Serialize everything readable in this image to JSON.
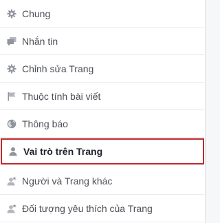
{
  "menu": {
    "items": [
      {
        "label": "Chung",
        "icon": "gear-icon"
      },
      {
        "label": "Nhắn tin",
        "icon": "message-icon"
      },
      {
        "label": "Chỉnh sửa Trang",
        "icon": "gear-icon"
      },
      {
        "label": "Thuộc tính bài viết",
        "icon": "flag-icon"
      },
      {
        "label": "Thông báo",
        "icon": "globe-icon"
      },
      {
        "label": "Vai trò trên Trang",
        "icon": "person-icon",
        "active": true
      },
      {
        "label": "Người và Trang khác",
        "icon": "person-star-icon"
      },
      {
        "label": "Đối tượng yêu thích của Trang",
        "icon": "person-star-icon"
      }
    ]
  },
  "colors": {
    "active_border": "#c0282d",
    "icon": "#90949c",
    "text": "#4b4f56"
  }
}
